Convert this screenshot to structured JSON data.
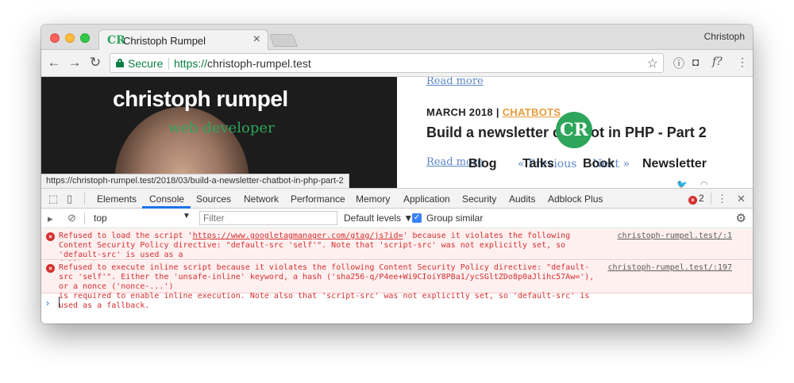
{
  "browser": {
    "tab_title": "Christoph Rumpel",
    "tab_favicon": "CR",
    "profile_name": "Christoph",
    "secure_label": "Secure",
    "url_scheme": "https://",
    "url_host": "christoph-rumpel.test",
    "extensions": [
      "info-icon",
      "pocket-icon",
      "font-icon",
      "more-icon"
    ],
    "font_ext_label": "f?"
  },
  "page": {
    "hero_name": "christoph rumpel",
    "hero_role": "web developer",
    "read_more_1": "Read more",
    "post_date": "MARCH 2018 |",
    "post_category": "CHATBOTS",
    "logo_text": "CR",
    "post_title": "Build a newsletter chatbot in PHP - Part 2",
    "read_more_2": "Read more",
    "menu": [
      "Blog",
      "Talks",
      "Book",
      "Newsletter"
    ],
    "pager_prev": "« Previous",
    "pager_next": "Next »",
    "status_url": "https://christoph-rumpel.test/2018/03/build-a-newsletter-chatbot-in-php-part-2"
  },
  "devtools": {
    "tabs": [
      "Elements",
      "Console",
      "Sources",
      "Network",
      "Performance",
      "Memory",
      "Application",
      "Security",
      "Audits",
      "Adblock Plus"
    ],
    "active_tab": "Console",
    "error_count": "2",
    "context": "top",
    "filter_placeholder": "Filter",
    "levels_label": "Default levels ▼",
    "group_similar": "Group similar",
    "messages": [
      {
        "text_before": "Refused to load the script '",
        "link": "https://www.googletagmanager.com/gtag/js?id=",
        "text_after": "' because it violates the following\nContent Security Policy directive: \"default-src 'self'\". Note that 'script-src' was not explicitly set, so 'default-src' is used as a\nfallback.",
        "source": "christoph-rumpel.test/:1"
      },
      {
        "text": "Refused to execute inline script because it violates the following Content Security Policy directive: \"default-\nsrc 'self'\". Either the 'unsafe-inline' keyword, a hash ('sha256-q/P4ee+Wi9CIoiY8PBa1/ycSGltZDo8p0aJlihc57Aw='), or a nonce ('nonce-...')\nis required to enable inline execution. Note also that 'script-src' was not explicitly set, so 'default-src' is used as a fallback.",
        "source": "christoph-rumpel.test/:197"
      }
    ],
    "prompt_symbol": "›"
  },
  "colors": {
    "secure_green": "#0b8043",
    "brand_green": "#2ea55b",
    "category_orange": "#e89b3a",
    "error_red": "#d32f2f",
    "link_blue": "#5b86c7"
  }
}
